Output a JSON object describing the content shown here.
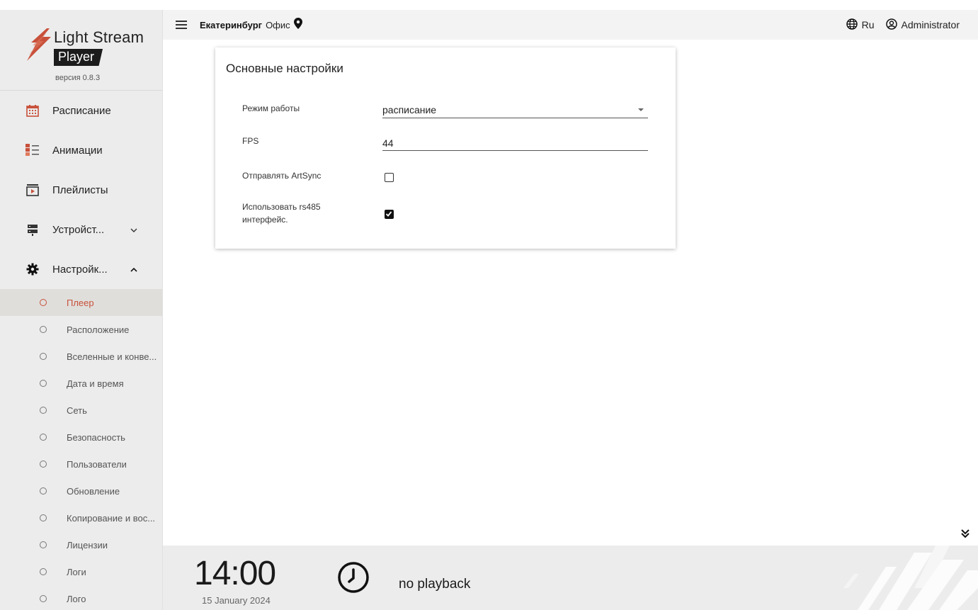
{
  "brand": {
    "name": "Light Stream",
    "product": "Player",
    "version": "версия 0.8.3",
    "accent": "#c8503a"
  },
  "sidebar": {
    "items": [
      {
        "label": "Расписание",
        "icon": "calendar-icon"
      },
      {
        "label": "Анимации",
        "icon": "animations-icon"
      },
      {
        "label": "Плейлисты",
        "icon": "playlist-icon"
      },
      {
        "label": "Устройст...",
        "icon": "devices-icon",
        "chevron": "collapsed"
      },
      {
        "label": "Настройк...",
        "icon": "gear-icon",
        "chevron": "expanded"
      }
    ],
    "sub_items": [
      {
        "label": "Плеер",
        "active": true
      },
      {
        "label": "Расположение"
      },
      {
        "label": "Вселенные и конве..."
      },
      {
        "label": "Дата и время"
      },
      {
        "label": "Сеть"
      },
      {
        "label": "Безопасность"
      },
      {
        "label": "Пользователи"
      },
      {
        "label": "Обновление"
      },
      {
        "label": "Копирование и вос..."
      },
      {
        "label": "Лицензии"
      },
      {
        "label": "Логи"
      },
      {
        "label": "Лого"
      }
    ]
  },
  "header": {
    "city": "Екатеринбург",
    "location": "Офис",
    "language": "Ru",
    "user": "Administrator"
  },
  "settings": {
    "title": "Основные настройки",
    "mode_label": "Режим работы",
    "mode_value": "расписание",
    "fps_label": "FPS",
    "fps_value": "44",
    "artsync_label": "Отправлять ArtSync",
    "artsync_checked": false,
    "rs485_label_1": "Использовать rs485",
    "rs485_label_2": "интерфейс.",
    "rs485_checked": true
  },
  "footer": {
    "time": "14:00",
    "date": "15 January 2024",
    "playback_status": "no playback"
  }
}
